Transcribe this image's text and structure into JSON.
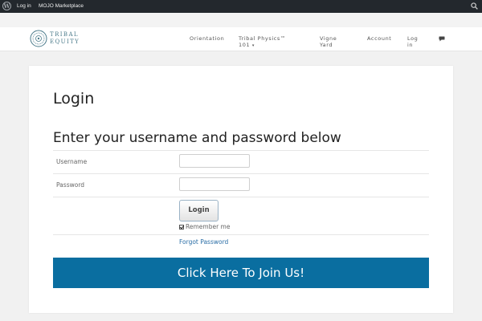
{
  "admin_bar": {
    "login_label": "Log in",
    "marketplace_label": "MOJO Marketplace"
  },
  "header": {
    "logo_line1": "TRIBAL",
    "logo_line2": "EQUITY",
    "nav": [
      {
        "line1": "Orientation",
        "line2": ""
      },
      {
        "line1": "Tribal Physics™",
        "line2": "101"
      },
      {
        "line1": "Vigne",
        "line2": "Yard"
      },
      {
        "line1": "Account",
        "line2": ""
      },
      {
        "line1": "Log",
        "line2": "in"
      }
    ],
    "nav_chevron": "▾"
  },
  "main": {
    "title": "Login",
    "subtitle": "Enter your username and password below",
    "username_label": "Username",
    "password_label": "Password",
    "username_value": "",
    "password_value": "",
    "login_button": "Login",
    "remember_label": "Remember me",
    "remember_checked": true,
    "forgot_link": "Forgot Password",
    "join_button": "Click Here To Join Us!"
  },
  "colors": {
    "admin_bar_bg": "#23282d",
    "join_button_bg": "#0a6ea0",
    "link": "#2a6ea6",
    "logo": "#4a7a8a"
  }
}
